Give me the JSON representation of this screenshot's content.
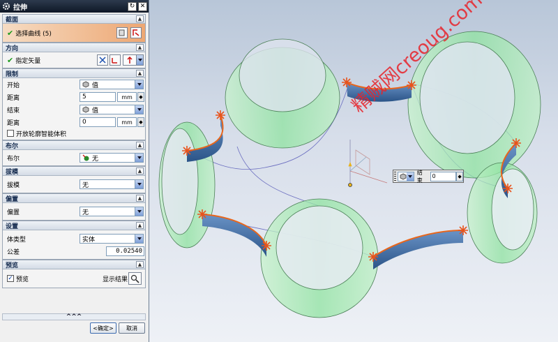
{
  "dialog": {
    "title": "拉伸",
    "more_label": "^^^",
    "ok_label": "<确定>",
    "cancel_label": "取消",
    "sections": {
      "section": {
        "title": "截面",
        "select_curve": "选择曲线 (5)"
      },
      "direction": {
        "title": "方向",
        "specify_vector": "指定矢量"
      },
      "limits": {
        "title": "限制",
        "start_label": "开始",
        "start_value": "值",
        "start_distance_label": "距离",
        "start_distance": "5",
        "start_unit": "mm",
        "end_label": "结束",
        "end_value": "值",
        "end_distance_label": "距离",
        "end_distance": "0",
        "end_unit": "mm",
        "open_profile_label": "开放轮廓智能体积"
      },
      "boolean": {
        "title": "布尔",
        "label": "布尔",
        "value": "无"
      },
      "draft": {
        "title": "拔模",
        "label": "拔模",
        "value": "无"
      },
      "offset": {
        "title": "偏置",
        "label": "偏置",
        "value": "无"
      },
      "settings": {
        "title": "设置",
        "body_type_label": "体类型",
        "body_type": "实体",
        "tolerance_label": "公差",
        "tolerance": "0.02540"
      },
      "preview": {
        "title": "预览",
        "preview_label": "预览",
        "show_result_label": "显示结果"
      }
    }
  },
  "floating_input": {
    "label": "结束",
    "value": "0"
  },
  "watermark": "精贼网creoug.com",
  "colors": {
    "accent_orange": "#eda773",
    "surface_green": "#9be6a8",
    "edge_orange": "#e8661c",
    "blue_face": "#3f6ea5",
    "title_bar": "#0e1726"
  }
}
